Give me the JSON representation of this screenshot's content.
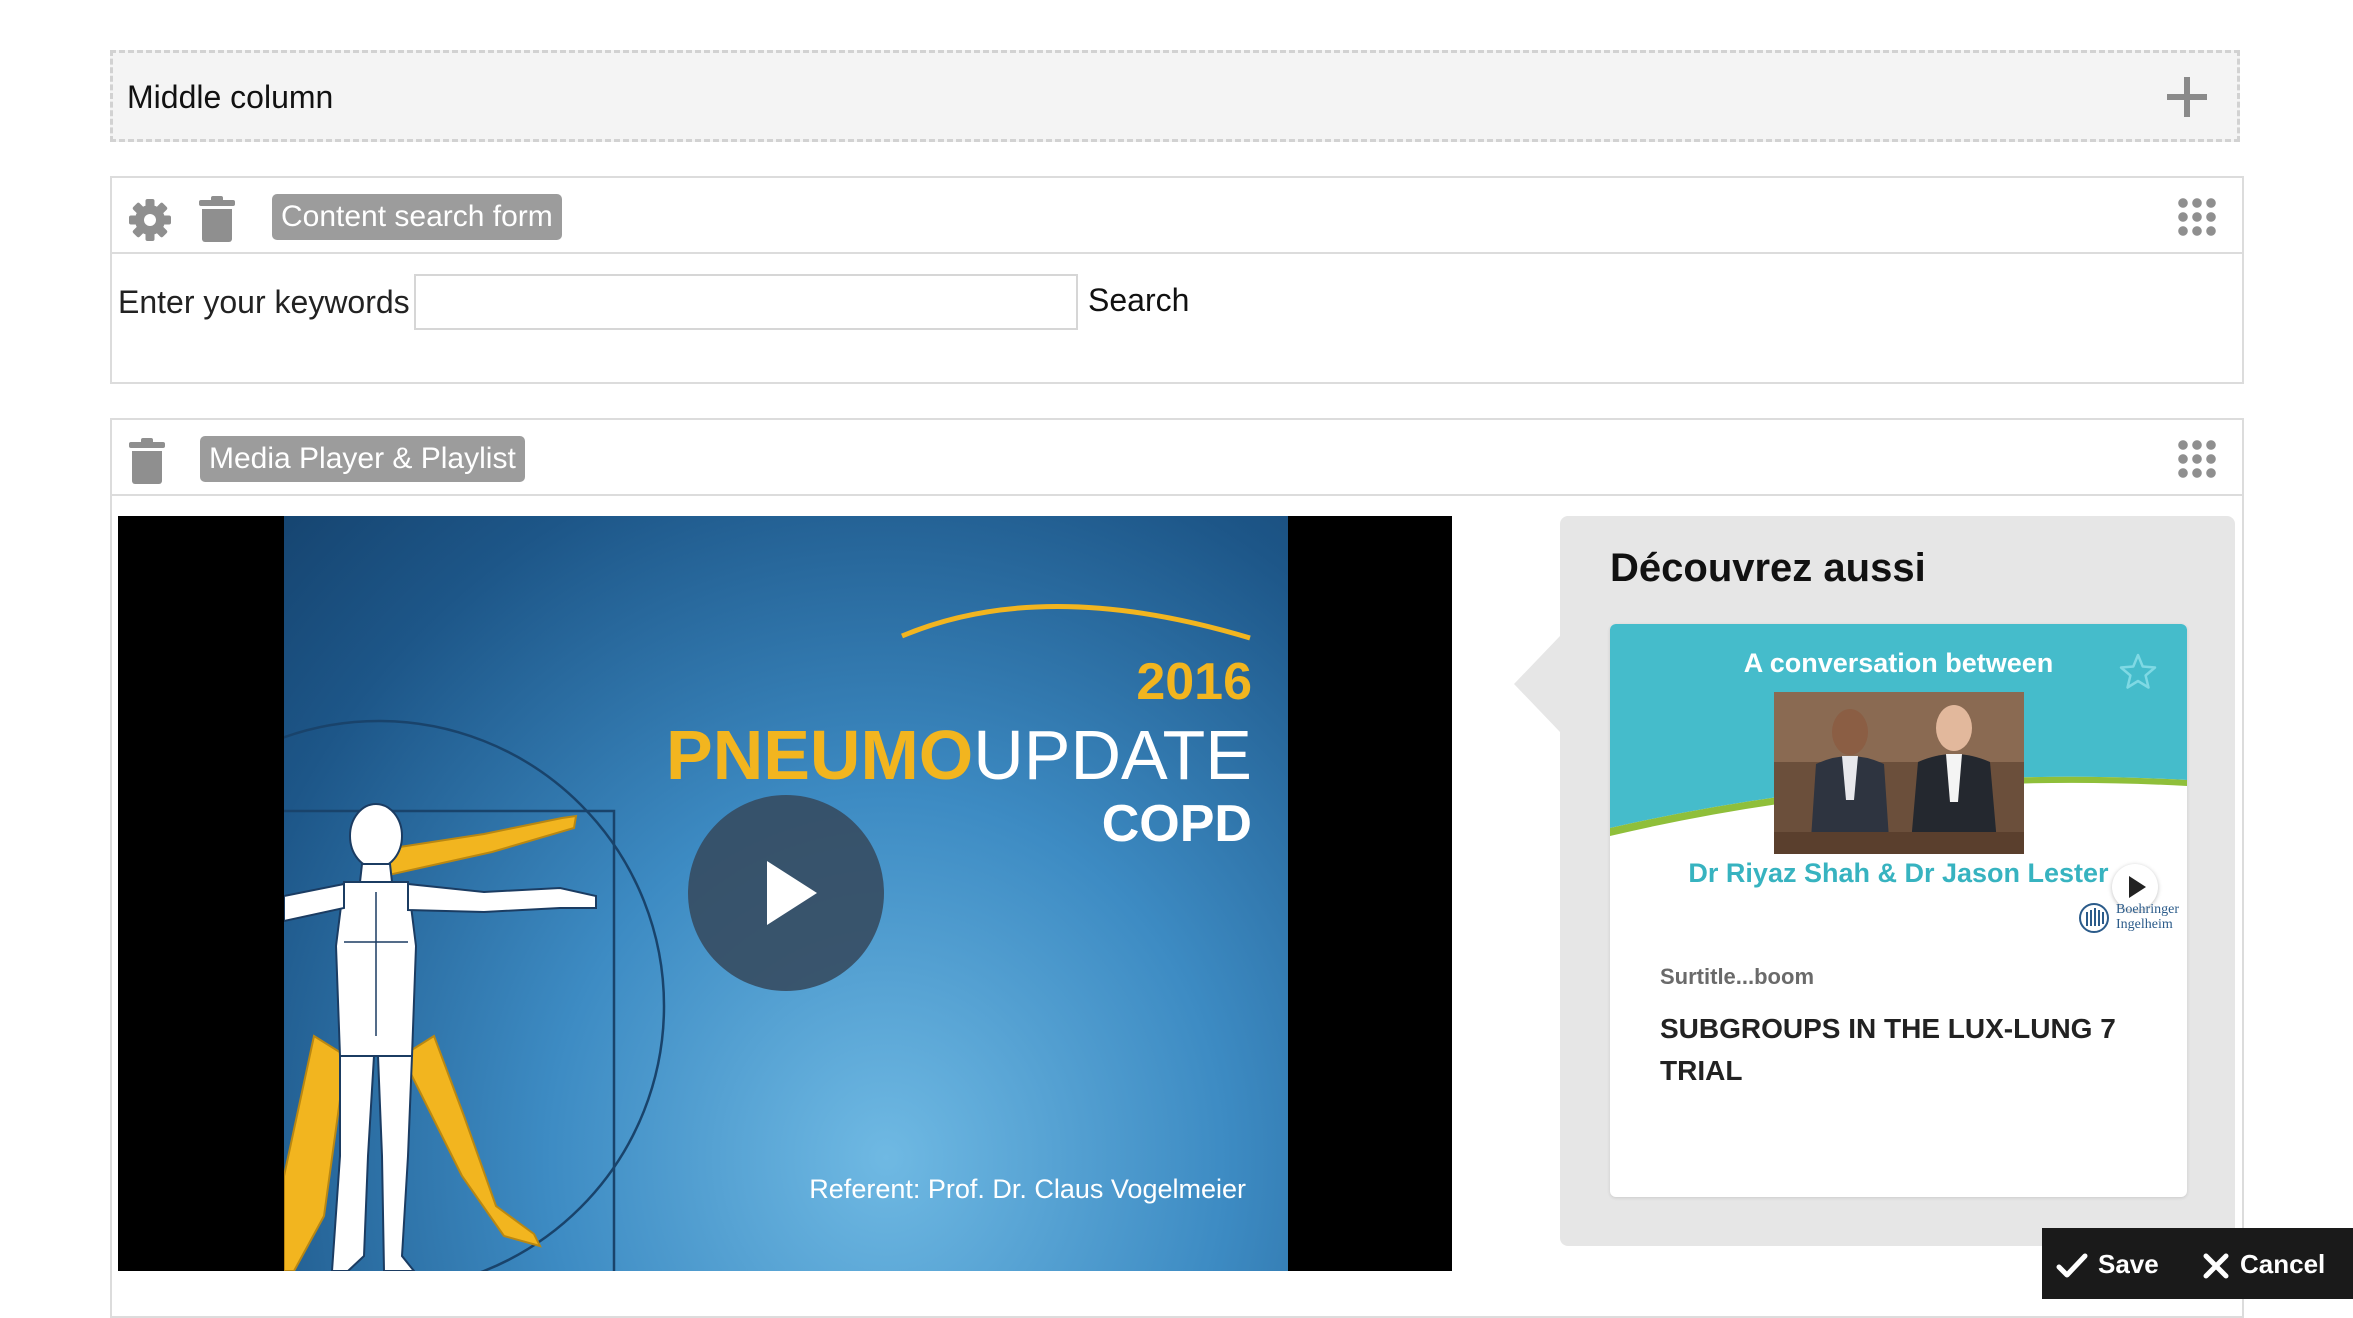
{
  "region": {
    "label": "Middle column",
    "add_icon": "plus-icon"
  },
  "search_block": {
    "tag": "Content search form",
    "icons": [
      "gear-icon",
      "trash-icon",
      "grip-icon"
    ],
    "label": "Enter your keywords",
    "input_value": "",
    "button_label": "Search"
  },
  "media_block": {
    "tag": "Media Player & Playlist",
    "icons": [
      "trash-icon",
      "grip-icon"
    ],
    "video": {
      "year": "2016",
      "brand_a": "PNEUMO",
      "brand_b": "UPDATE",
      "subtitle": "COPD",
      "referent": "Referent: Prof. Dr. Claus Vogelmeier",
      "play_icon": "play-icon"
    },
    "playlist": {
      "title": "Découvrez aussi",
      "card": {
        "thumb_heading": "A conversation between",
        "thumb_names": "Dr Riyaz Shah & Dr Jason Lester",
        "logo_line1": "Boehringer",
        "logo_line2": "Ingelheim",
        "surtitle": "Surtitle...boom",
        "title": "SUBGROUPS IN THE LUX-LUNG 7 TRIAL",
        "icons": [
          "star-icon",
          "play-icon"
        ]
      }
    }
  },
  "actions": {
    "save_label": "Save",
    "cancel_label": "Cancel"
  },
  "colors": {
    "tag_bg": "#9c9c9c",
    "brand_orange": "#f2b51f",
    "thumb_teal": "#45bccb",
    "actionbar_bg": "#1a1a1a"
  }
}
